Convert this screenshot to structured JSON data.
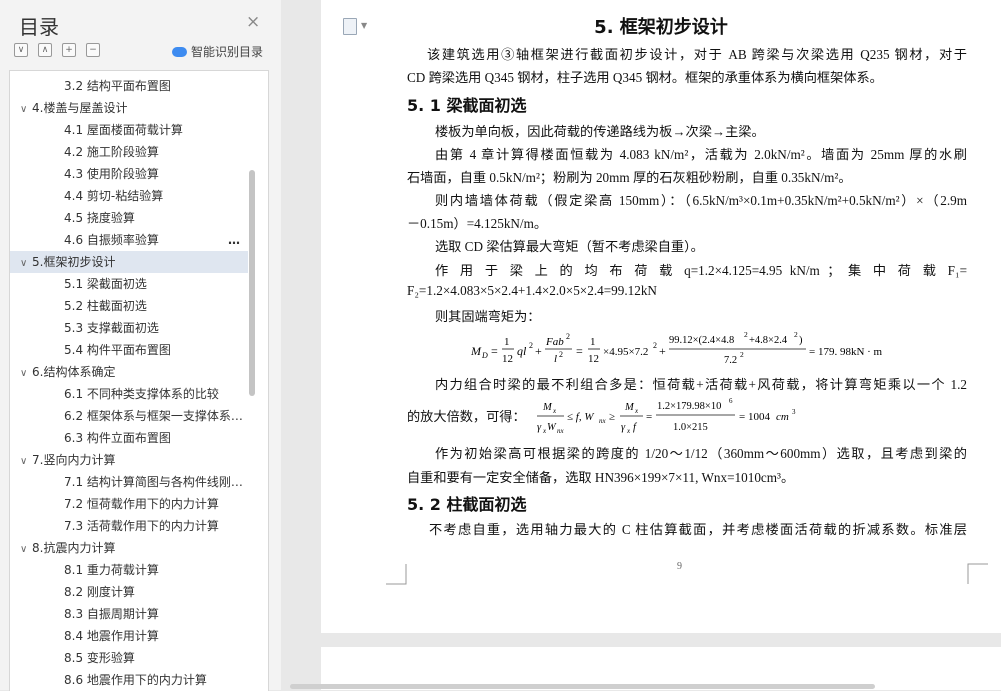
{
  "sidebar": {
    "title": "目录",
    "close": "×",
    "ai_label": "智能识别目录",
    "more": "…",
    "items": [
      {
        "label": "3.2  结构平面布置图",
        "level": 2,
        "exp": ""
      },
      {
        "label": "4.楼盖与屋盖设计",
        "level": 1,
        "exp": "∨"
      },
      {
        "label": "4.1  屋面楼面荷载计算",
        "level": 2,
        "exp": ""
      },
      {
        "label": "4.2  施工阶段验算",
        "level": 2,
        "exp": ""
      },
      {
        "label": "4.3  使用阶段验算",
        "level": 2,
        "exp": ""
      },
      {
        "label": "4.4  剪切-粘结验算",
        "level": 2,
        "exp": ""
      },
      {
        "label": "4.5  挠度验算",
        "level": 2,
        "exp": ""
      },
      {
        "label": "4.6  自振频率验算",
        "level": 2,
        "exp": ""
      },
      {
        "label": "5.框架初步设计",
        "level": 1,
        "exp": "∨"
      },
      {
        "label": "5.1  梁截面初选",
        "level": 2,
        "exp": ""
      },
      {
        "label": "5.2  柱截面初选",
        "level": 2,
        "exp": ""
      },
      {
        "label": "5.3  支撑截面初选",
        "level": 2,
        "exp": ""
      },
      {
        "label": "5.4  构件平面布置图",
        "level": 2,
        "exp": ""
      },
      {
        "label": "6.结构体系确定",
        "level": 1,
        "exp": "∨"
      },
      {
        "label": "6.1  不同种类支撑体系的比较",
        "level": 2,
        "exp": ""
      },
      {
        "label": "6.2  框架体系与框架一支撑体系…",
        "level": 2,
        "exp": ""
      },
      {
        "label": "6.3  构件立面布置图",
        "level": 2,
        "exp": ""
      },
      {
        "label": "7.竖向内力计算",
        "level": 1,
        "exp": "∨"
      },
      {
        "label": "7.1  结构计算简图与各构件线刚…",
        "level": 2,
        "exp": ""
      },
      {
        "label": "7.2  恒荷载作用下的内力计算",
        "level": 2,
        "exp": ""
      },
      {
        "label": "7.3  活荷载作用下的内力计算",
        "level": 2,
        "exp": ""
      },
      {
        "label": "8.抗震内力计算",
        "level": 1,
        "exp": "∨"
      },
      {
        "label": "8.1  重力荷载计算",
        "level": 2,
        "exp": ""
      },
      {
        "label": "8.2  刚度计算",
        "level": 2,
        "exp": ""
      },
      {
        "label": "8.3  自振周期计算",
        "level": 2,
        "exp": ""
      },
      {
        "label": "8.4  地震作用计算",
        "level": 2,
        "exp": ""
      },
      {
        "label": "8.5  变形验算",
        "level": 2,
        "exp": ""
      },
      {
        "label": "8.6  地震作用下的内力计算",
        "level": 2,
        "exp": ""
      }
    ]
  },
  "doc": {
    "heading": "5. 框架初步设计",
    "h_51": "5. 1  梁截面初选",
    "h_52": "5. 2  柱截面初选",
    "p1_l1": "该建筑选用③轴框架进行截面初步设计，对于 AB 跨梁与次梁选用 Q235 钢材，对于",
    "p1_l2": "CD 跨梁选用 Q345 钢材，柱子选用 Q345 钢材。框架的承重体系为横向框架体系。",
    "p2": "楼板为单向板，因此荷载的传递路线为板→次梁→主梁。",
    "p3_l1": "由第 4 章计算得楼面恒载为 4.083 kN/m²，活载为 2.0kN/m²。墙面为 25mm 厚的水刷",
    "p3_l2": "石墙面，自重 0.5kN/m²；粉刷为 20mm 厚的石灰粗砂粉刷，自重 0.35kN/m²。",
    "p4_l1": "则内墙墙体荷载（假定梁高 150mm）：（6.5kN/m³×0.1m+0.35kN/m²+0.5kN/m²）×（2.9m",
    "p4_l2": "－0.15m）=4.125kN/m。",
    "p5": "选取 CD 梁估算最大弯矩（暂不考虑梁自重）。",
    "p6_l1": "作 用 于 梁 上 的 均 布 荷 载  q=1.2×4.125=4.95  kN/m ； 集 中 荷 载  F₁=",
    "p6_l2": "F₂=1.2×4.083×5×2.4+1.4×2.0×5×2.4=99.12kN",
    "p7": "则其固端弯矩为：",
    "eq1": "M_D = 1/12 ql² + Fab²/l² = 1/12 × 4.95 × 7.2² + 99.12 × (2.4 × 4.8² + 4.8 × 2.4²)/7.2² = 179.98kN·m",
    "p8_l1": "内力组合时梁的最不利组合多是：恒荷载+活荷载+风荷载，将计算弯矩乘以一个 1.2",
    "p8_l2_pre": "的放大倍数，可得：",
    "eq2": "Mx/(γx Wnx) ≤ f, Wnx ≥ Mx/(γx f) = 1.2×179.98×10⁶/(1.0×215) = 1004cm³",
    "p9_l1": "作为初始梁高可根据梁的跨度的 1/20～1/12（360mm～600mm）选取，且考虑到梁的",
    "p9_l2": "自重和要有一定安全储备，选取 HN396×199×7×11, Wnx=1010cm³。",
    "p10": "不考虑自重，选用轴力最大的 C 柱估算截面，并考虑楼面活荷载的折减系数。标准层",
    "page_number": "9"
  }
}
